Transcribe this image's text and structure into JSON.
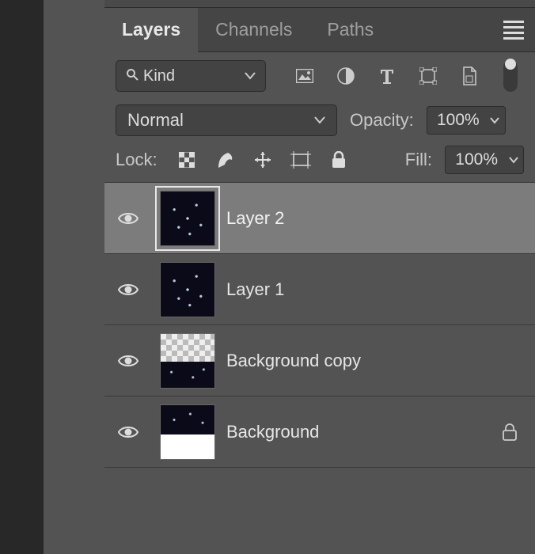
{
  "tabs": {
    "layers": "Layers",
    "channels": "Channels",
    "paths": "Paths",
    "active": "layers"
  },
  "filter": {
    "kind_label": "Kind"
  },
  "blend": {
    "mode": "Normal",
    "opacity_label": "Opacity:",
    "opacity_value": "100%"
  },
  "lock": {
    "label": "Lock:",
    "fill_label": "Fill:",
    "fill_value": "100%"
  },
  "layers": [
    {
      "name": "Layer 2",
      "selected": true,
      "locked": false,
      "thumb": "sparkle"
    },
    {
      "name": "Layer 1",
      "selected": false,
      "locked": false,
      "thumb": "sparkle"
    },
    {
      "name": "Background copy",
      "selected": false,
      "locked": false,
      "thumb": "bgcopy"
    },
    {
      "name": "Background",
      "selected": false,
      "locked": true,
      "thumb": "bg-layer"
    }
  ]
}
